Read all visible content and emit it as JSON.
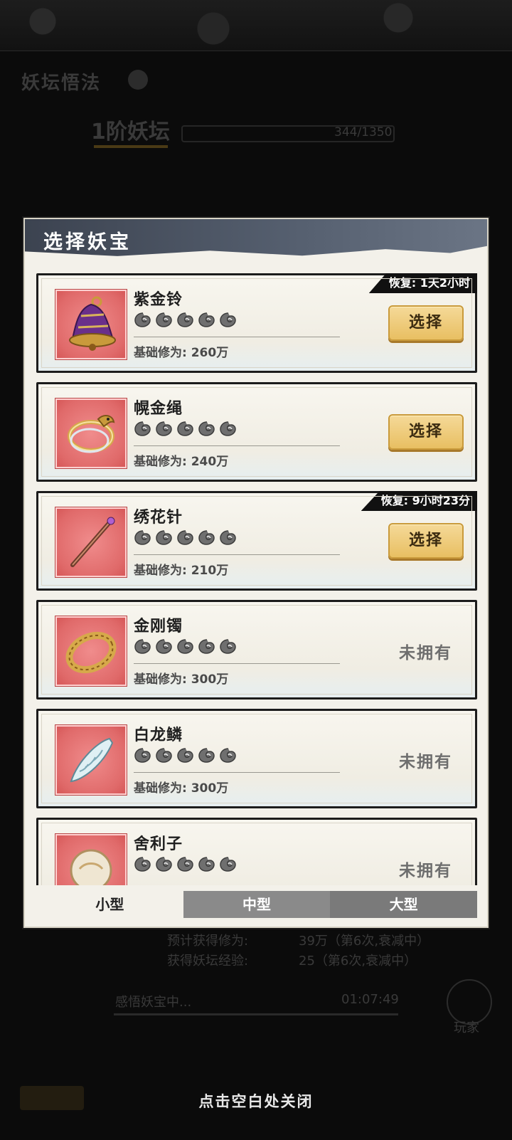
{
  "background": {
    "title": "妖坛悟法",
    "level": "1阶妖坛",
    "progress": "344/1350",
    "expected_cultivation_label": "预计获得修为:",
    "expected_cultivation_value": "39万（第6次,衰减中）",
    "altar_exp_label": "获得妖坛经验:",
    "altar_exp_value": "25（第6次,衰减中）",
    "status_text": "感悟妖宝中...",
    "timer": "01:07:49",
    "avatar_label": "玩家"
  },
  "modal": {
    "title": "选择妖宝",
    "stat_label": "基础修为:",
    "select_label": "选择",
    "not_owned_label": "未拥有",
    "items": [
      {
        "name": "紫金铃",
        "stars": 5,
        "stat": "基础修为: 260万",
        "action": "select",
        "cooldown": "恢复: 1天2小时",
        "icon": "purple-bell-icon"
      },
      {
        "name": "幌金绳",
        "stars": 5,
        "stat": "基础修为: 240万",
        "action": "select",
        "cooldown": "",
        "icon": "golden-rope-icon"
      },
      {
        "name": "绣花针",
        "stars": 5,
        "stat": "基础修为: 210万",
        "action": "select",
        "cooldown": "恢复: 9小时23分",
        "icon": "needle-icon"
      },
      {
        "name": "金刚镯",
        "stars": 5,
        "stat": "基础修为: 300万",
        "action": "not_owned",
        "cooldown": "",
        "icon": "gold-bracelet-icon"
      },
      {
        "name": "白龙鳞",
        "stars": 5,
        "stat": "基础修为: 300万",
        "action": "not_owned",
        "cooldown": "",
        "icon": "dragon-scale-icon"
      },
      {
        "name": "舍利子",
        "stars": 5,
        "stat": "",
        "action": "not_owned",
        "cooldown": "",
        "icon": "relic-orb-icon"
      }
    ],
    "tabs": [
      {
        "label": "小型",
        "active": true
      },
      {
        "label": "中型",
        "active": false
      },
      {
        "label": "大型",
        "active": false
      }
    ]
  },
  "close_hint": "点击空白处关闭",
  "colors": {
    "select_button": "#e8bf62",
    "thumb_bg": "#e06a6a",
    "header": "#566070"
  }
}
